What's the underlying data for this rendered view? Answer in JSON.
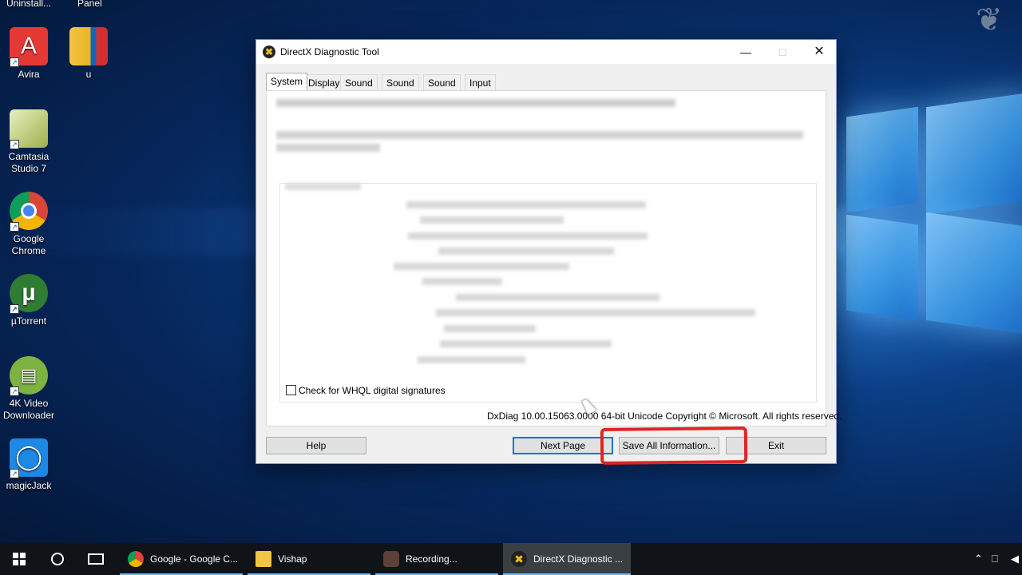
{
  "desktop": {
    "cut_labels": [
      "Uninstall...",
      "Panel"
    ],
    "icons": [
      {
        "label": "Avira"
      },
      {
        "label": "u"
      },
      {
        "label": "Camtasia Studio 7"
      },
      {
        "label": "Google Chrome"
      },
      {
        "label": "µTorrent"
      },
      {
        "label": "4K Video Downloader"
      },
      {
        "label": "magicJack"
      }
    ]
  },
  "dialog": {
    "title": "DirectX Diagnostic Tool",
    "tabs": [
      "System",
      "Display",
      "Sound 1",
      "Sound 2",
      "Sound 3",
      "Input"
    ],
    "active_tab": "System",
    "whql_checkbox_label": "Check for WHQL digital signatures",
    "whql_checked": false,
    "copyright": "DxDiag 10.00.15063.0000 64-bit Unicode  Copyright © Microsoft. All rights reserved.",
    "buttons": {
      "help": "Help",
      "next_page": "Next Page",
      "save_all": "Save All Information...",
      "exit": "Exit"
    }
  },
  "taskbar": {
    "items": [
      {
        "label": "Google - Google C...",
        "icon": "chrome-icon"
      },
      {
        "label": "Vishap",
        "icon": "folder-icon"
      },
      {
        "label": "Recording...",
        "icon": "recording-icon"
      },
      {
        "label": "DirectX Diagnostic ...",
        "icon": "directx-icon",
        "active": true
      }
    ]
  },
  "colors": {
    "highlight": "#e02424",
    "accent": "#0078d7"
  }
}
